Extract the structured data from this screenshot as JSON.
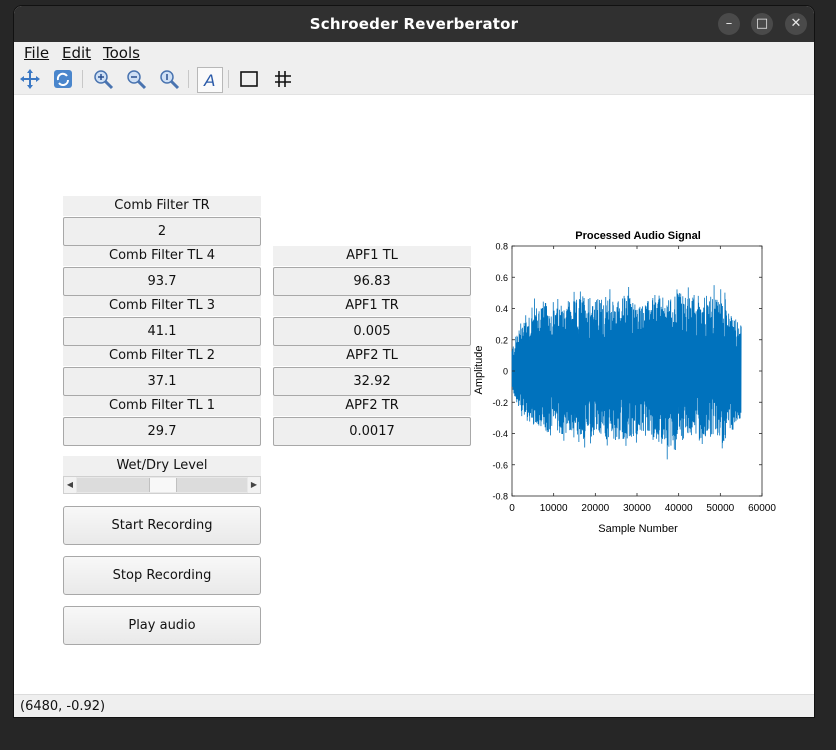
{
  "window": {
    "title": "Schroeder Reverberator"
  },
  "menu": {
    "file": "File",
    "edit": "Edit",
    "tools": "Tools"
  },
  "toolbar": [
    "pan-icon",
    "rotate-icon",
    "zoom-in-icon",
    "zoom-out-icon",
    "zoom-reset-icon",
    "text-insert-icon",
    "box-icon",
    "grid-icon"
  ],
  "controls": {
    "comb_tr": {
      "label": "Comb Filter TR",
      "value": "2"
    },
    "comb_tl4": {
      "label": "Comb Filter TL 4",
      "value": "93.7"
    },
    "comb_tl3": {
      "label": "Comb Filter TL 3",
      "value": "41.1"
    },
    "comb_tl2": {
      "label": "Comb Filter TL 2",
      "value": "37.1"
    },
    "comb_tl1": {
      "label": "Comb Filter TL 1",
      "value": "29.7"
    },
    "apf1_tl": {
      "label": "APF1 TL",
      "value": "96.83"
    },
    "apf1_tr": {
      "label": "APF1 TR",
      "value": "0.005"
    },
    "apf2_tl": {
      "label": "APF2 TL",
      "value": "32.92"
    },
    "apf2_tr": {
      "label": "APF2 TR",
      "value": "0.0017"
    },
    "wetdry": {
      "label": "Wet/Dry Level",
      "value_fraction": 0.5
    }
  },
  "buttons": {
    "start": "Start Recording",
    "stop": "Stop Recording",
    "play": "Play audio"
  },
  "status": {
    "coords": "(6480, -0.92)"
  },
  "colors": {
    "signal": "#0072bd",
    "titlebar": "#303030"
  },
  "chart_data": {
    "type": "line",
    "title": "Processed Audio Signal",
    "xlabel": "Sample Number",
    "ylabel": "Amplitude",
    "xlim": [
      0,
      60000
    ],
    "ylim": [
      -0.8,
      0.8
    ],
    "xticks": [
      "0",
      "10000",
      "20000",
      "30000",
      "40000",
      "50000",
      "60000"
    ],
    "yticks": [
      "-0.8",
      "-0.6",
      "-0.4",
      "-0.2",
      "0",
      "0.2",
      "0.4",
      "0.6",
      "0.8"
    ],
    "num_samples": 55000,
    "series": [
      {
        "x": [
          0,
          2500,
          5000,
          7500,
          10000,
          12500,
          15000,
          17500,
          20000,
          22500,
          25000,
          27500,
          30000,
          32500,
          35000,
          37500,
          40000,
          42500,
          45000,
          47500,
          50000,
          52500,
          55000
        ],
        "upper": [
          0.15,
          0.35,
          0.4,
          0.45,
          0.4,
          0.42,
          0.45,
          0.5,
          0.46,
          0.48,
          0.45,
          0.5,
          0.42,
          0.45,
          0.48,
          0.46,
          0.52,
          0.47,
          0.5,
          0.48,
          0.48,
          0.4,
          0.3
        ],
        "lower": [
          -0.12,
          -0.3,
          -0.35,
          -0.4,
          -0.38,
          -0.42,
          -0.38,
          -0.45,
          -0.4,
          -0.42,
          -0.46,
          -0.44,
          -0.42,
          -0.38,
          -0.45,
          -0.5,
          -0.43,
          -0.4,
          -0.45,
          -0.42,
          -0.47,
          -0.4,
          -0.3
        ]
      }
    ],
    "grid": false
  }
}
